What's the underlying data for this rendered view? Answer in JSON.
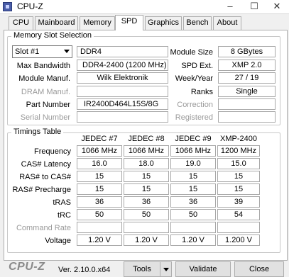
{
  "window": {
    "title": "CPU-Z",
    "controls": {
      "minimize": "–",
      "maximize": "☐",
      "close": "✕"
    }
  },
  "tabs": [
    "CPU",
    "Mainboard",
    "Memory",
    "SPD",
    "Graphics",
    "Bench",
    "About"
  ],
  "active_tab": "SPD",
  "memory_slot": {
    "group_title": "Memory Slot Selection",
    "slot": "Slot #1",
    "type": "DDR4",
    "module_size_label": "Module Size",
    "module_size": "8 GBytes",
    "max_bandwidth_label": "Max Bandwidth",
    "max_bandwidth": "DDR4-2400 (1200 MHz)",
    "spd_ext_label": "SPD Ext.",
    "spd_ext": "XMP 2.0",
    "module_manuf_label": "Module Manuf.",
    "module_manuf": "Wilk Elektronik",
    "week_year_label": "Week/Year",
    "week_year": "27 / 19",
    "dram_manuf_label": "DRAM Manuf.",
    "dram_manuf": "",
    "ranks_label": "Ranks",
    "ranks": "Single",
    "part_number_label": "Part Number",
    "part_number": "IR2400D464L15S/8G",
    "correction_label": "Correction",
    "correction": "",
    "serial_number_label": "Serial Number",
    "serial_number": "",
    "registered_label": "Registered",
    "registered": ""
  },
  "timings": {
    "group_title": "Timings Table",
    "columns": [
      "JEDEC #7",
      "JEDEC #8",
      "JEDEC #9",
      "XMP-2400"
    ],
    "rows": [
      {
        "label": "Frequency",
        "values": [
          "1066 MHz",
          "1066 MHz",
          "1066 MHz",
          "1200 MHz"
        ]
      },
      {
        "label": "CAS# Latency",
        "values": [
          "16.0",
          "18.0",
          "19.0",
          "15.0"
        ]
      },
      {
        "label": "RAS# to CAS#",
        "values": [
          "15",
          "15",
          "15",
          "15"
        ]
      },
      {
        "label": "RAS# Precharge",
        "values": [
          "15",
          "15",
          "15",
          "15"
        ]
      },
      {
        "label": "tRAS",
        "values": [
          "36",
          "36",
          "36",
          "39"
        ]
      },
      {
        "label": "tRC",
        "values": [
          "50",
          "50",
          "50",
          "54"
        ]
      },
      {
        "label": "Command Rate",
        "values": [
          "",
          "",
          "",
          ""
        ]
      },
      {
        "label": "Voltage",
        "values": [
          "1.20 V",
          "1.20 V",
          "1.20 V",
          "1.200 V"
        ]
      }
    ]
  },
  "footer": {
    "logo": "CPU-Z",
    "version": "Ver. 2.10.0.x64",
    "tools_label": "Tools",
    "validate_label": "Validate",
    "close_label": "Close"
  }
}
